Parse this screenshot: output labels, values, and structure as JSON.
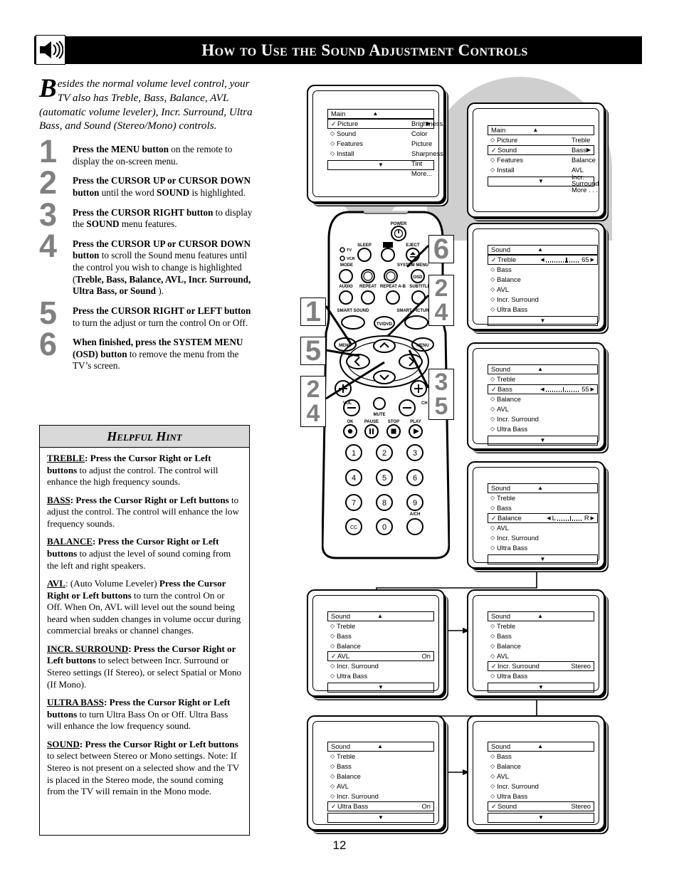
{
  "header": {
    "title": "How to Use the Sound Adjustment Controls",
    "icon": "speaker-sound-icon"
  },
  "intro": {
    "dropcap": "B",
    "text": "esides the normal volume level control, your TV also has Treble,  Bass, Balance, AVL (automatic volume leveler), Incr. Surround, Ultra Bass, and Sound (Stereo/Mono) controls."
  },
  "steps": [
    {
      "num": "1",
      "html": "<b>Press the MENU button</b> on the remote to display the on-screen menu."
    },
    {
      "num": "2",
      "html": "<b>Press the CURSOR UP or CURSOR DOWN button</b> until the word <b>SOUND</b> is highlighted."
    },
    {
      "num": "3",
      "html": "<b>Press the CURSOR RIGHT button</b> to display the <b>SOUND</b> menu features."
    },
    {
      "num": "4",
      "html": "<b>Press the CURSOR UP or  CURSOR DOWN button</b> to scroll the Sound menu features until the control you wish to change is highlighted (<b>Treble, Bass, Balance, AVL, Incr. Surround, Ultra Bass, or Sound</b> )."
    },
    {
      "num": "5",
      "html": "<b>Press the CURSOR RIGHT or LEFT button</b> to turn the adjust or turn the control On or Off."
    },
    {
      "num": "6",
      "html": "<b>When finished, press the SYSTEM MENU (OSD) button</b> to remove the menu from the TV&rsquo;s screen."
    }
  ],
  "hint": {
    "title": "Helpful Hint",
    "paragraphs": [
      {
        "term": "TREBLE",
        "html": "<span class=\"term\">TREBLE</span><b>:  Press the Cursor Right or Left buttons</b> to adjust the control. The control will enhance the high frequency sounds."
      },
      {
        "term": "BASS",
        "html": "<span class=\"term\">BASS</span><b>:  Press the Cursor Right or Left buttons</b> to adjust the control. The control will enhance the low frequency sounds."
      },
      {
        "term": "BALANCE",
        "html": "<span class=\"term\">BALANCE</span><b>:  Press the Cursor Right or Left buttons</b> to adjust the level of sound coming from the left and right speakers."
      },
      {
        "term": "AVL",
        "html": "<span class=\"term\">AVL</span>:  (Auto Volume Leveler) <b>Press the Cursor Right or Left buttons</b> to turn the control On or Off. When On, AVL will level out the sound being heard when sudden changes in volume occur during commercial breaks or channel changes."
      },
      {
        "term": "INCR. SURROUND",
        "html": "<span class=\"term\">INCR. SURROUND</span><b>: Press the Cursor Right or Left buttons</b> to select between Incr. Surround or Stereo settings (If Stereo), or select Spatial or Mono (If Mono)."
      },
      {
        "term": "ULTRA BASS",
        "html": "<span class=\"term\">ULTRA BASS</span><b>: Press the Cursor Right or Left buttons</b> to turn Ultra Bass On or Off. Ultra Bass will enhance the low frequency sound."
      },
      {
        "term": "SOUND",
        "html": "<span class=\"term\">SOUND</span><b>: Press the Cursor Right or Left buttons</b> to select between Stereo or Mono settings. Note: If Stereo is not present on a selected show and the TV is placed in the Stereo mode, the sound coming from the TV will remain in the Mono mode."
      }
    ]
  },
  "page_number": "12",
  "screens": [
    {
      "id": "main-picture",
      "header": "Main",
      "rows": [
        {
          "label": "Picture",
          "marker": "check",
          "selected": true,
          "arrow": true
        },
        {
          "label": "Sound",
          "marker": "diamond"
        },
        {
          "label": "Features",
          "marker": "diamond"
        },
        {
          "label": "Install",
          "marker": "diamond"
        }
      ],
      "submenu": [
        "Brightness",
        "Color",
        "Picture",
        "Sharpness",
        "Tint",
        "More..."
      ]
    },
    {
      "id": "main-sound",
      "header": "Main",
      "rows": [
        {
          "label": "Picture",
          "marker": "diamond"
        },
        {
          "label": "Sound",
          "marker": "check",
          "selected": true,
          "arrow": true
        },
        {
          "label": "Features",
          "marker": "diamond"
        },
        {
          "label": "Install",
          "marker": "diamond"
        }
      ],
      "submenu": [
        "Treble",
        "Bass",
        "Balance",
        "AVL",
        "Incr. Surround",
        "More . . ."
      ]
    },
    {
      "id": "sound-treble",
      "header": "Sound",
      "rows": [
        {
          "label": "Treble",
          "marker": "check",
          "selected": true,
          "slider": {
            "value": "65",
            "pos": 62
          }
        },
        {
          "label": "Bass",
          "marker": "diamond"
        },
        {
          "label": "Balance",
          "marker": "diamond"
        },
        {
          "label": "AVL",
          "marker": "diamond"
        },
        {
          "label": "Incr. Surround",
          "marker": "diamond"
        },
        {
          "label": "Ultra Bass",
          "marker": "diamond"
        }
      ]
    },
    {
      "id": "sound-bass",
      "header": "Sound",
      "rows": [
        {
          "label": "Treble",
          "marker": "diamond"
        },
        {
          "label": "Bass",
          "marker": "check",
          "selected": true,
          "slider": {
            "value": "55",
            "pos": 52
          }
        },
        {
          "label": "Balance",
          "marker": "diamond"
        },
        {
          "label": "AVL",
          "marker": "diamond"
        },
        {
          "label": "Incr. Surround",
          "marker": "diamond"
        },
        {
          "label": "Ultra Bass",
          "marker": "diamond"
        }
      ]
    },
    {
      "id": "sound-balance",
      "header": "Sound",
      "rows": [
        {
          "label": "Treble",
          "marker": "diamond"
        },
        {
          "label": "Bass",
          "marker": "diamond"
        },
        {
          "label": "Balance",
          "marker": "check",
          "selected": true,
          "balance": {
            "left": "L",
            "right": "R",
            "pos": 50
          }
        },
        {
          "label": "AVL",
          "marker": "diamond"
        },
        {
          "label": "Incr. Surround",
          "marker": "diamond"
        },
        {
          "label": "Ultra Bass",
          "marker": "diamond"
        }
      ]
    },
    {
      "id": "sound-avl",
      "header": "Sound",
      "rows": [
        {
          "label": "Treble",
          "marker": "diamond"
        },
        {
          "label": "Bass",
          "marker": "diamond"
        },
        {
          "label": "Balance",
          "marker": "diamond"
        },
        {
          "label": "AVL",
          "marker": "check",
          "selected": true,
          "value": "On"
        },
        {
          "label": "Incr. Surround",
          "marker": "diamond"
        },
        {
          "label": "Ultra Bass",
          "marker": "diamond"
        }
      ]
    },
    {
      "id": "sound-incr-surround",
      "header": "Sound",
      "rows": [
        {
          "label": "Treble",
          "marker": "diamond"
        },
        {
          "label": "Bass",
          "marker": "diamond"
        },
        {
          "label": "Balance",
          "marker": "diamond"
        },
        {
          "label": "AVL",
          "marker": "diamond"
        },
        {
          "label": "Incr. Surround",
          "marker": "check",
          "selected": true,
          "value": "Stereo"
        },
        {
          "label": "Ultra Bass",
          "marker": "diamond"
        }
      ]
    },
    {
      "id": "sound-ultra-bass",
      "header": "Sound",
      "rows": [
        {
          "label": "Treble",
          "marker": "diamond"
        },
        {
          "label": "Bass",
          "marker": "diamond"
        },
        {
          "label": "Balance",
          "marker": "diamond"
        },
        {
          "label": "AVL",
          "marker": "diamond"
        },
        {
          "label": "Incr. Surround",
          "marker": "diamond"
        },
        {
          "label": "Ultra Bass",
          "marker": "check",
          "selected": true,
          "value": "On"
        }
      ]
    },
    {
      "id": "sound-stereo",
      "header": "Sound",
      "rows": [
        {
          "label": "Bass",
          "marker": "diamond"
        },
        {
          "label": "Balance",
          "marker": "diamond"
        },
        {
          "label": "AVL",
          "marker": "diamond"
        },
        {
          "label": "Incr. Surround",
          "marker": "diamond"
        },
        {
          "label": "Ultra Bass",
          "marker": "diamond"
        },
        {
          "label": "Sound",
          "marker": "check",
          "selected": true,
          "value": "Stereo"
        }
      ]
    }
  ],
  "callouts": [
    {
      "id": "callout-1",
      "lines": [
        "1"
      ]
    },
    {
      "id": "callout-5",
      "lines": [
        "5"
      ]
    },
    {
      "id": "callout-2-4-left",
      "lines": [
        "2",
        "4"
      ]
    },
    {
      "id": "callout-6",
      "lines": [
        "6"
      ]
    },
    {
      "id": "callout-2-4-right",
      "lines": [
        "2",
        "4"
      ]
    },
    {
      "id": "callout-3-5",
      "lines": [
        "3",
        "5"
      ]
    }
  ],
  "remote": {
    "labels": {
      "power": "POWER",
      "sleep": "SLEEP",
      "eject": "EJECT",
      "tv": "TV",
      "vcr": "VCR",
      "mode": "MODE",
      "system_menu": "SYSTEM MENU",
      "osd": "OSD",
      "audio": "AUDIO",
      "repeat": "REPEAT",
      "repeat_ab": "REPEAT A-B",
      "subtitle": "SUBTITLE",
      "smart_sound": "SMART SOUND",
      "tv_dvd": "TV/DVD",
      "smart_picture": "SMART PICTURE",
      "menu_left": "MENU",
      "menu_right": "MENU",
      "vol": "VOL",
      "ch": "CH",
      "mute": "MUTE",
      "rec": "OK",
      "pause": "PAUSE",
      "stop": "STOP",
      "play": "PLAY",
      "cc": "CC",
      "ach": "A/CH"
    },
    "keypad": [
      "1",
      "2",
      "3",
      "4",
      "5",
      "6",
      "7",
      "8",
      "9",
      "CC",
      "0",
      ""
    ]
  }
}
